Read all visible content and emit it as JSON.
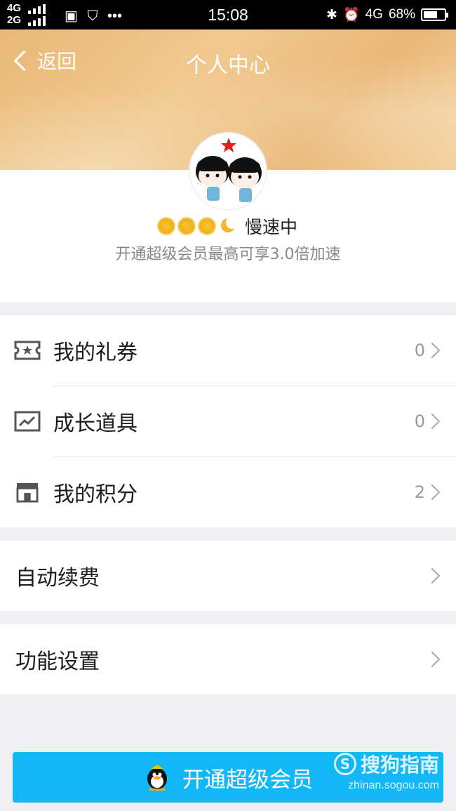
{
  "status_bar": {
    "network_top": "4G",
    "network_bottom": "2G",
    "time": "15:08",
    "network_type": "4G",
    "battery": "68%",
    "battery_level": 0.68
  },
  "header": {
    "back_label": "返回",
    "title": "个人中心"
  },
  "profile": {
    "level_status": "慢速中",
    "level_icons": [
      "sun-icon",
      "sun-icon",
      "sun-icon",
      "moon-icon"
    ],
    "subtitle": "开通超级会员最高可享3.0倍加速"
  },
  "menu_group_1": [
    {
      "label": "我的礼券",
      "count": "0",
      "icon": "ticket-icon"
    },
    {
      "label": "成长道具",
      "count": "0",
      "icon": "growth-chart-icon"
    },
    {
      "label": "我的积分",
      "count": "2",
      "icon": "store-icon"
    }
  ],
  "menu_group_2": {
    "label": "自动续费"
  },
  "menu_group_3": {
    "label": "功能设置"
  },
  "bottom_button": {
    "label": "开通超级会员"
  },
  "watermark": {
    "brand": "搜狗指南",
    "url": "zhinan.sogou.com"
  },
  "colors": {
    "accent": "#12b7f5",
    "header_gold": "#eab877",
    "background": "#efeff4"
  }
}
